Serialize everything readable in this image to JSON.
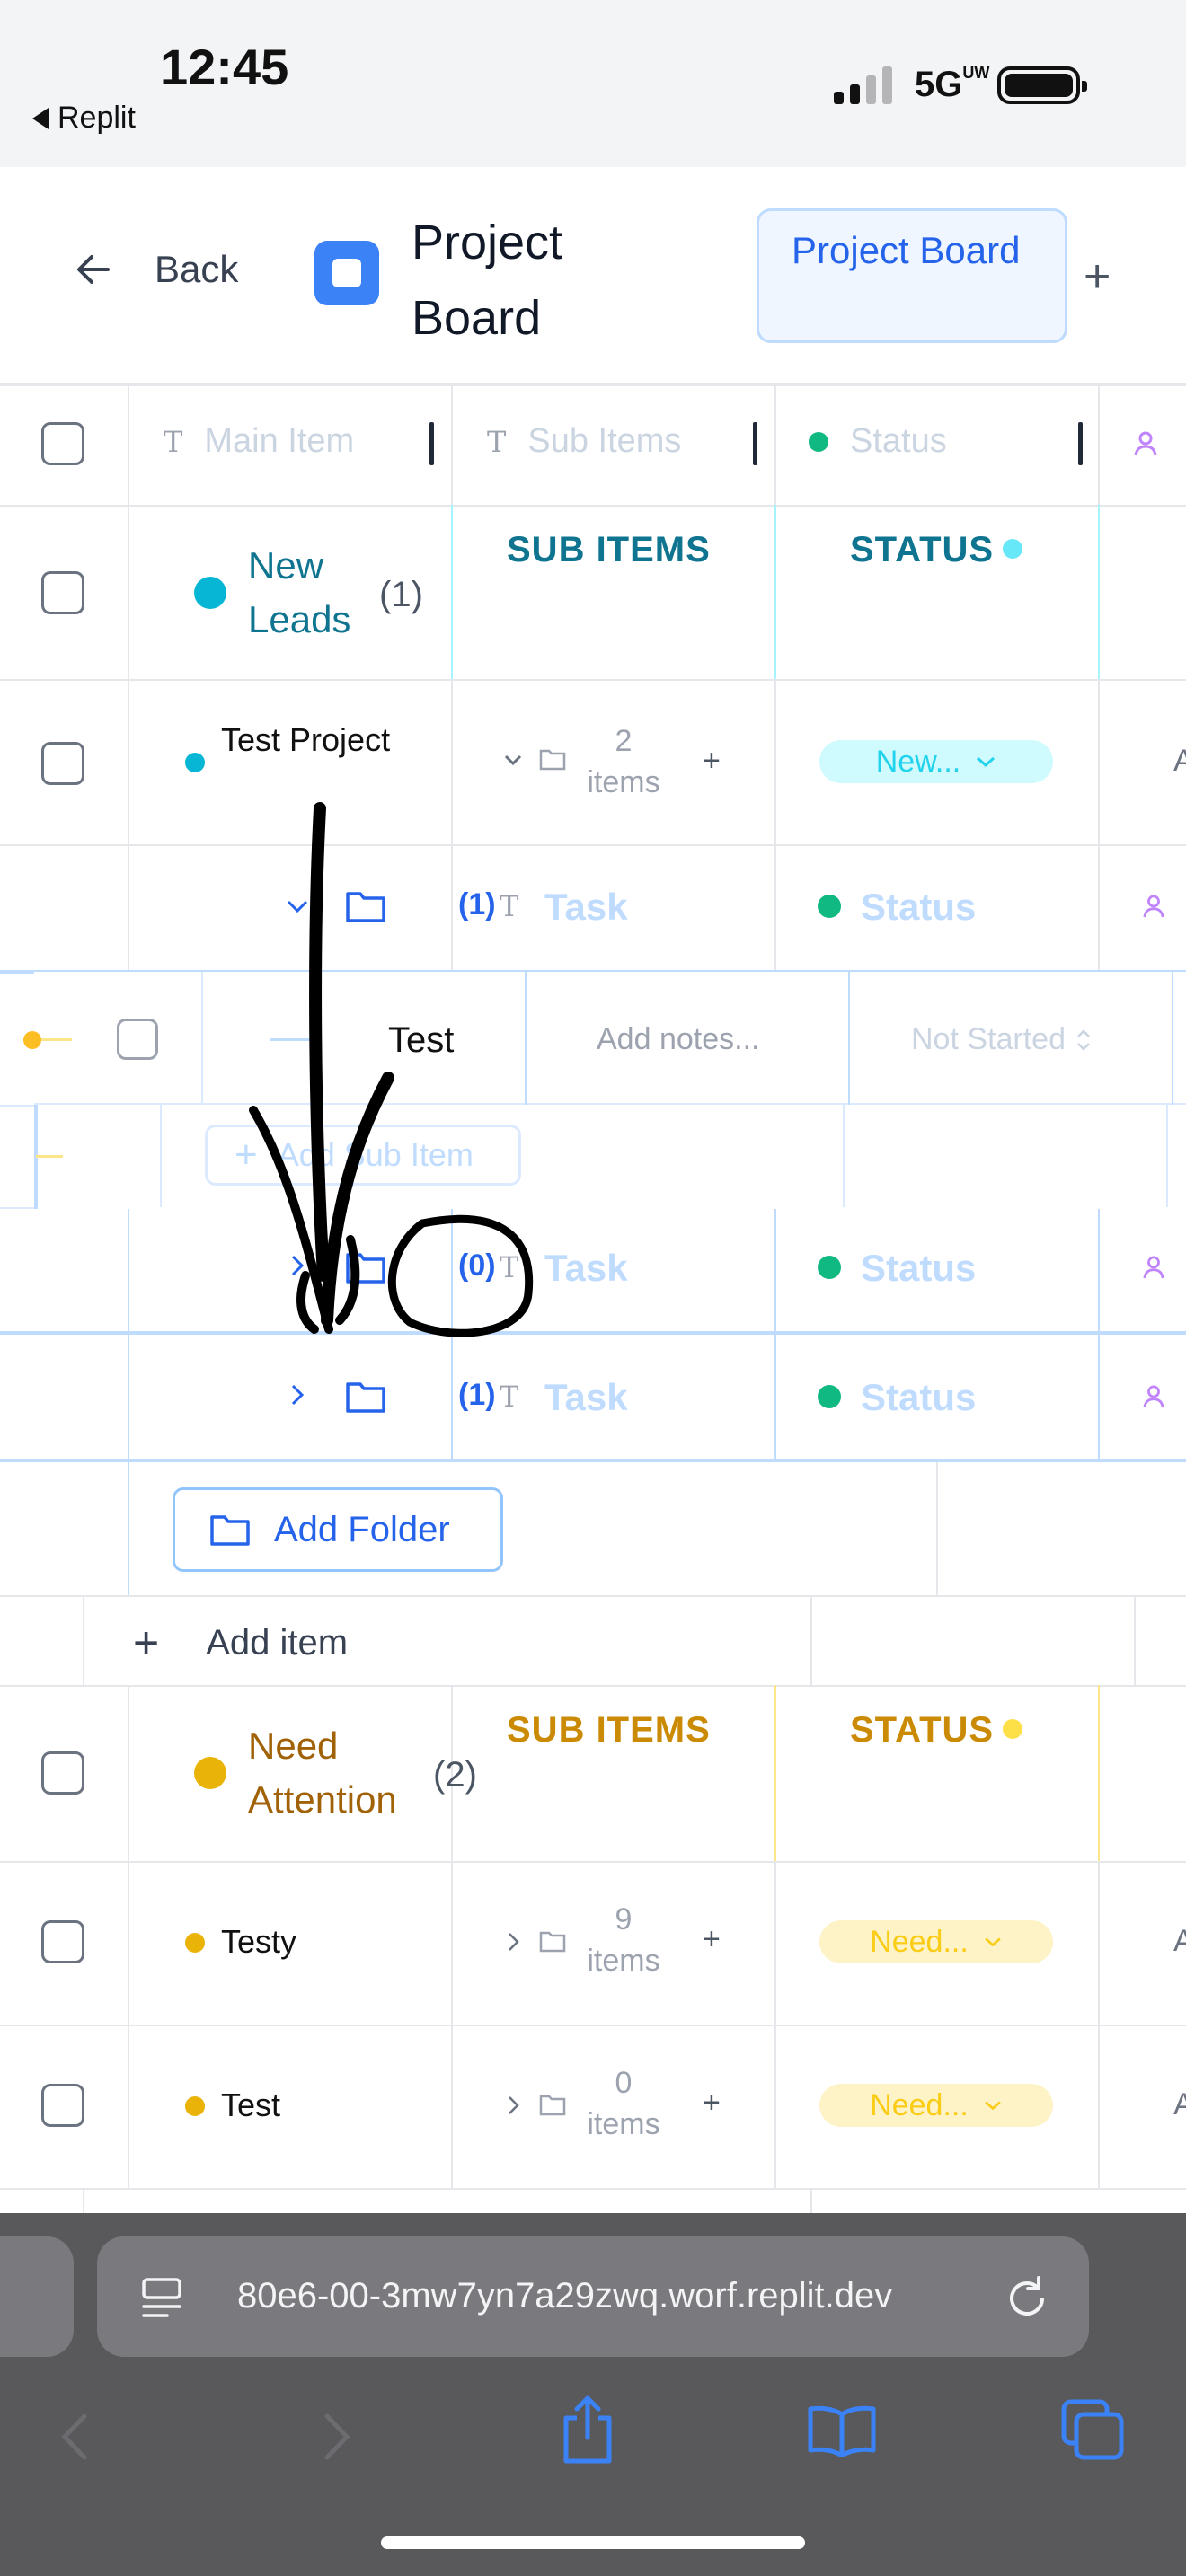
{
  "status_bar": {
    "time": "12:45",
    "back_app": "Replit",
    "network": "5G",
    "network_sup": "UW"
  },
  "header": {
    "back_label": "Back",
    "title": "Project Board",
    "tab_label": "Project Board",
    "add_tab": "+"
  },
  "columns": {
    "main_item": "Main Item",
    "sub_items": "Sub Items",
    "status": "Status"
  },
  "groups": [
    {
      "name": "New Leads",
      "count": "(1)",
      "color": "#06b6d4",
      "name_color": "#0e7490",
      "sub_items_label": "SUB ITEMS",
      "status_label": "STATUS",
      "items": [
        {
          "name": "Test Project",
          "sub_count": "2",
          "sub_unit": "items",
          "status": "New..."
        }
      ],
      "folders": [
        {
          "count": "(1)",
          "task": "Task",
          "status": "Status"
        },
        {
          "count": "(0)",
          "task": "Task",
          "status": "Status"
        },
        {
          "count": "(1)",
          "task": "Task",
          "status": "Status"
        }
      ],
      "sub_item": {
        "name": "Test",
        "notes_placeholder": "Add notes...",
        "status": "Not Started"
      },
      "add_sub_item": "Add Sub Item",
      "add_folder": "Add Folder",
      "add_item": "Add item"
    },
    {
      "name": "Need Attention",
      "count": "(2)",
      "color": "#eab308",
      "name_color": "#a16207",
      "sub_items_label": "SUB ITEMS",
      "status_label": "STATUS",
      "items": [
        {
          "name": "Testy",
          "sub_count": "9",
          "sub_unit": "items",
          "status": "Need..."
        },
        {
          "name": "Test",
          "sub_count": "0",
          "sub_unit": "items",
          "status": "Need..."
        }
      ]
    }
  ],
  "browser": {
    "url": "80e6-00-3mw7yn7a29zwq.worf.replit.dev"
  },
  "colors": {
    "accent": "#3b82f6",
    "cyan": "#06b6d4",
    "yellow": "#eab308",
    "green": "#10b981"
  }
}
